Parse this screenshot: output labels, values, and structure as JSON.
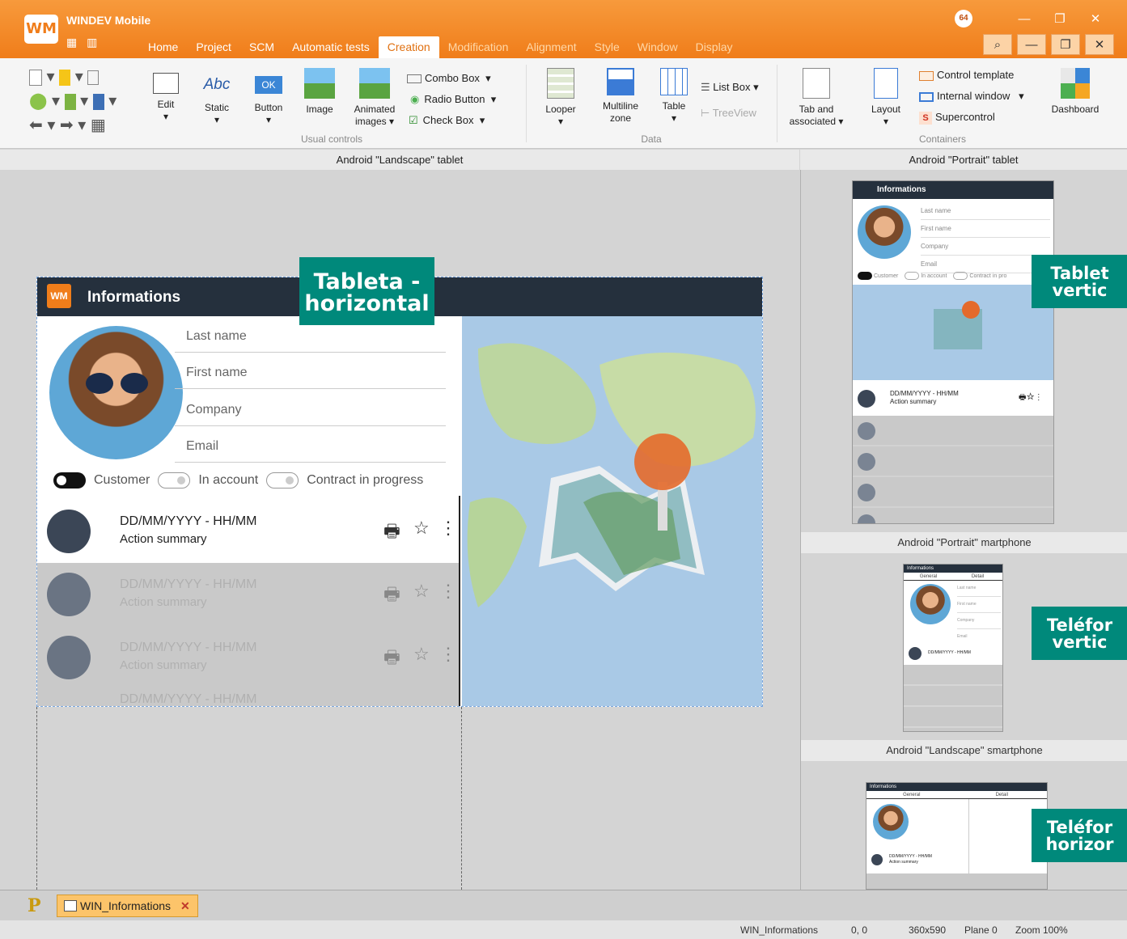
{
  "app": {
    "logo_text": "WM",
    "title": "WINDEV Mobile",
    "qat_icons": "▦ ▥",
    "badge": "64"
  },
  "tabs": [
    {
      "label": "Home",
      "state": "normal"
    },
    {
      "label": "Project",
      "state": "normal"
    },
    {
      "label": "SCM",
      "state": "normal"
    },
    {
      "label": "Automatic tests",
      "state": "normal"
    },
    {
      "label": "Creation",
      "state": "active"
    },
    {
      "label": "Modification",
      "state": "dim"
    },
    {
      "label": "Alignment",
      "state": "dim"
    },
    {
      "label": "Style",
      "state": "dim"
    },
    {
      "label": "Window",
      "state": "dim"
    },
    {
      "label": "Display",
      "state": "dim"
    }
  ],
  "window_buttons": {
    "minimize": "—",
    "restore": "❐",
    "close": "✕",
    "search": "⌕"
  },
  "ribbon": {
    "usual": {
      "label": "Usual controls",
      "edit": "Edit",
      "static": "Static",
      "static_icon": "Abc",
      "button": "Button",
      "button_icon": "OK",
      "image": "Image",
      "animated": "Animated images",
      "combo": "Combo Box",
      "radio": "Radio Button",
      "check": "Check Box"
    },
    "data": {
      "label": "Data",
      "looper": "Looper",
      "multiline": "Multiline zone",
      "table": "Table",
      "listbox": "List Box",
      "treeview": "TreeView"
    },
    "containers": {
      "label": "Containers",
      "tab": "Tab and associated",
      "layout": "Layout",
      "control_template": "Control template",
      "internal_window": "Internal window",
      "supercontrol": "Supercontrol",
      "dashboard": "Dashboard"
    }
  },
  "panes": {
    "landscape_tablet": "Android \"Landscape\" tablet",
    "portrait_tablet": "Android \"Portrait\" tablet",
    "portrait_smartphone": "Android  \"Portrait\" martphone",
    "landscape_smartphone": "Android \"Landscape\" smartphone"
  },
  "callouts": {
    "tablet_h_1": "Tableta -",
    "tablet_h_2": "horizontal",
    "tablet_v_1": "Tablet",
    "tablet_v_2": "vertic",
    "phone_v_1": "Teléfor",
    "phone_v_2": "vertic",
    "phone_h_1": "Teléfor",
    "phone_h_2": "horizor"
  },
  "form": {
    "title": "Informations",
    "fields": [
      "Last name",
      "First name",
      "Company",
      "Email"
    ],
    "toggles": [
      "Customer",
      "In account",
      "Contract in progress"
    ],
    "rows": [
      {
        "date": "DD/MM/YYYY - HH/MM",
        "summary": "Action summary"
      },
      {
        "date": "DD/MM/YYYY - HH/MM",
        "summary": "Action summary"
      },
      {
        "date": "DD/MM/YYYY - HH/MM",
        "summary": "Action summary"
      },
      {
        "date": "DD/MM/YYYY - HH/MM",
        "summary": ""
      }
    ]
  },
  "mini_tablet": {
    "title": "Informations",
    "fields": [
      "Last name",
      "First name",
      "Company",
      "Email"
    ],
    "toggles": [
      "Customer",
      "In account",
      "Contract in pro"
    ],
    "row_date": "DD/MM/YYYY - HH/MM",
    "row_summary": "Action summary"
  },
  "mini_phone": {
    "title": "Informations",
    "tab1": "General",
    "tab2": "Detail",
    "fields": [
      "Last name",
      "First name",
      "Company",
      "Email"
    ],
    "row_date": "DD/MM/YYYY - HH/MM"
  },
  "mini_phone_l": {
    "title": "Informations",
    "tab1": "General",
    "tab2": "Detail",
    "row_date": "DD/MM/YYYY - HH/MM",
    "row_summary": "Action summary"
  },
  "doc_tab": {
    "p_icon": "P",
    "name": "WIN_Informations",
    "close": "✕"
  },
  "status": {
    "window": "WIN_Informations",
    "pos": "0, 0",
    "size": "360x590",
    "plane": "Plane 0",
    "zoom": "Zoom 100%"
  }
}
